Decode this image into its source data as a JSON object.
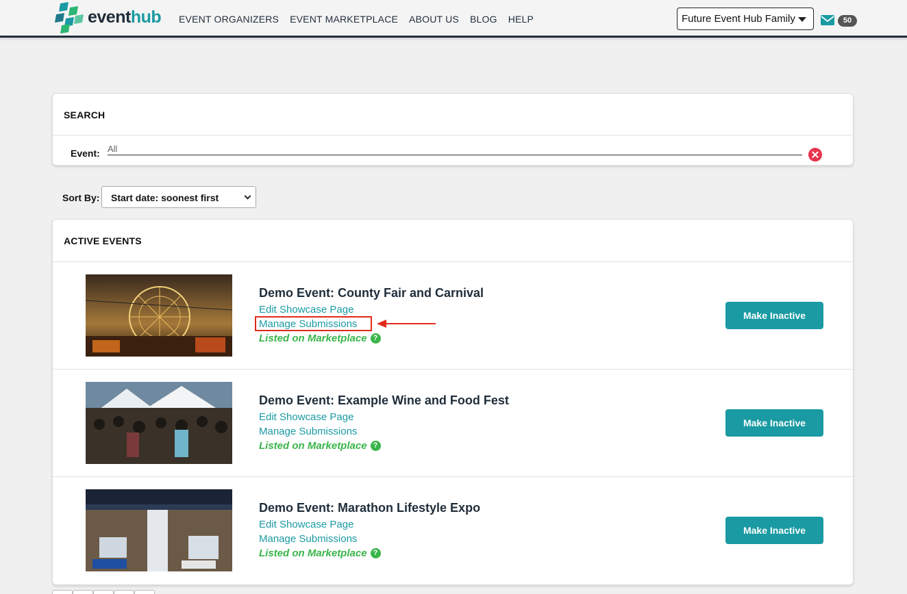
{
  "brand": {
    "name_prefix": "event",
    "name_suffix": "hub"
  },
  "nav": [
    "EVENT ORGANIZERS",
    "EVENT MARKETPLACE",
    "ABOUT US",
    "BLOG",
    "HELP"
  ],
  "account": {
    "selected": "Future Event Hub Family",
    "message_count": "50"
  },
  "search": {
    "title": "SEARCH",
    "event_label": "Event:",
    "event_value": "All"
  },
  "sort": {
    "label": "Sort By:",
    "selected": "Start date: soonest first"
  },
  "active_events": {
    "title": "ACTIVE EVENTS",
    "items": [
      {
        "title": "Demo Event: County Fair and Carnival",
        "edit_link": "Edit Showcase Page",
        "manage_link": "Manage Submissions",
        "status": "Listed on Marketplace",
        "action": "Make Inactive"
      },
      {
        "title": "Demo Event: Example Wine and Food Fest",
        "edit_link": "Edit Showcase Page",
        "manage_link": "Manage Submissions",
        "status": "Listed on Marketplace",
        "action": "Make Inactive"
      },
      {
        "title": "Demo Event: Marathon Lifestyle Expo",
        "edit_link": "Edit Showcase Page",
        "manage_link": "Manage Submissions",
        "status": "Listed on Marketplace",
        "action": "Make Inactive"
      }
    ]
  },
  "colors": {
    "accent": "#1a9aa3",
    "listed_green": "#39b54a",
    "highlight_red": "#e02a1a",
    "clear_red": "#e8344e"
  }
}
